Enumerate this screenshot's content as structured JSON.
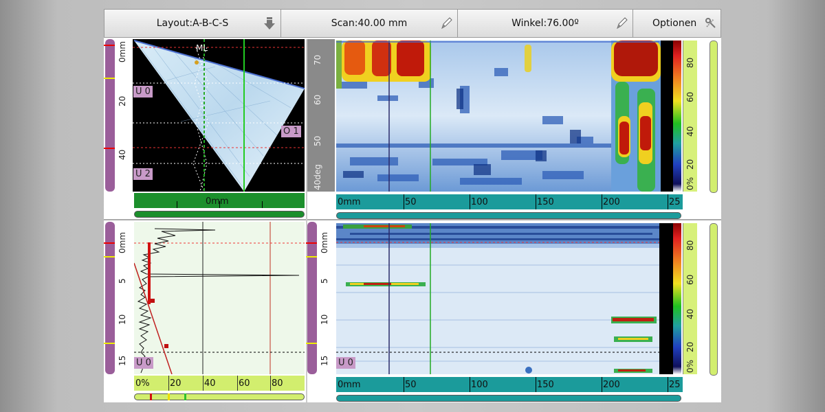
{
  "toolbar": {
    "layout_label": "Layout:A-B-C-S",
    "scan_label": "Scan:40.00 mm",
    "angle_label": "Winkel:76.00º",
    "options_label": "Optionen"
  },
  "sscan": {
    "marker_label": "ML",
    "depth_ticks": [
      "0mm",
      "20",
      "40"
    ],
    "gates": [
      "U 0",
      "O 1",
      "U 2"
    ],
    "bottom_label": "0mm"
  },
  "bscan_top": {
    "angle_ticks": [
      "70",
      "60",
      "50",
      "40deg"
    ],
    "x_ticks": [
      "0mm",
      "50",
      "100",
      "150",
      "200",
      "25"
    ],
    "colorbar_ticks": [
      "80",
      "60",
      "40",
      "20",
      "0%"
    ]
  },
  "ascan": {
    "depth_ticks": [
      "0mm",
      "5",
      "10",
      "15"
    ],
    "gate": "U 0",
    "amp_ticks": [
      "0%",
      "20",
      "40",
      "60",
      "80"
    ]
  },
  "bscan_bottom": {
    "gate": "U 0",
    "x_ticks": [
      "0mm",
      "50",
      "100",
      "150",
      "200",
      "25"
    ],
    "colorbar_ticks": [
      "80",
      "60",
      "40",
      "20",
      "0%"
    ]
  }
}
